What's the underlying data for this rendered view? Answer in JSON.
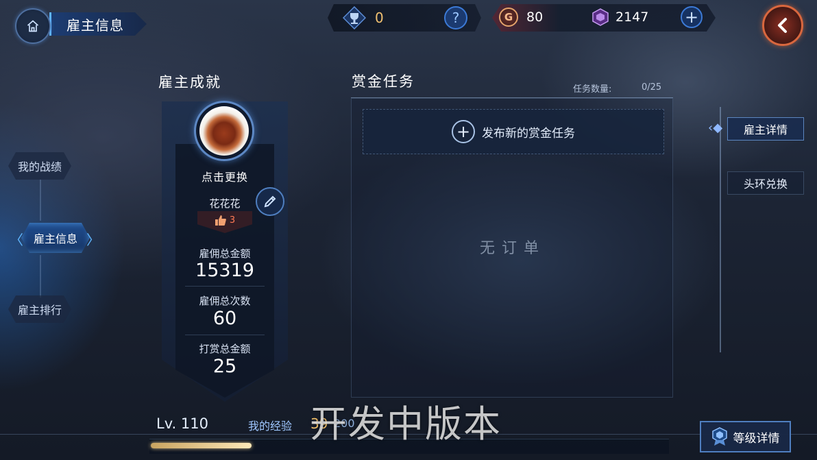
{
  "header": {
    "title": "雇主信息",
    "trophy_count": "0",
    "help_label": "?",
    "gold": {
      "icon_label": "G",
      "value": "80"
    },
    "gems": "2147",
    "add_label": "+"
  },
  "nav": {
    "items": [
      {
        "label": "我的战绩"
      },
      {
        "label": "雇主信息"
      },
      {
        "label": "雇主排行"
      }
    ]
  },
  "achievement": {
    "title": "雇主成就",
    "change_label": "点击更换",
    "name": "花花花",
    "likes": "3",
    "stats": [
      {
        "label": "雇佣总金额",
        "value": "15319"
      },
      {
        "label": "雇佣总次数",
        "value": "60"
      },
      {
        "label": "打赏总金额",
        "value": "25"
      }
    ]
  },
  "bounty": {
    "title": "赏金任务",
    "count_label": "任务数量:",
    "count_value": "0/25",
    "publish_label": "发布新的赏金任务",
    "empty_label": "无订单"
  },
  "right_tabs": [
    {
      "label": "雇主详情"
    },
    {
      "label": "头环兑换"
    }
  ],
  "footer": {
    "level": "Lv. 110",
    "exp_label": "我的经验",
    "exp_value": "39",
    "exp_max": "200",
    "exp_fraction": 0.195,
    "watermark": "开发中版本",
    "level_detail_label": "等级详情"
  },
  "colors": {
    "accent_blue": "#5fb6ff",
    "gold": "#f4c26a",
    "back_orange": "#d9673e"
  },
  "icons": [
    "home-icon",
    "trophy-icon",
    "help-icon",
    "gold-coin-icon",
    "gem-icon",
    "plus-icon",
    "back-arrow-icon",
    "pencil-icon",
    "thumbs-up-icon",
    "level-badge-icon"
  ]
}
